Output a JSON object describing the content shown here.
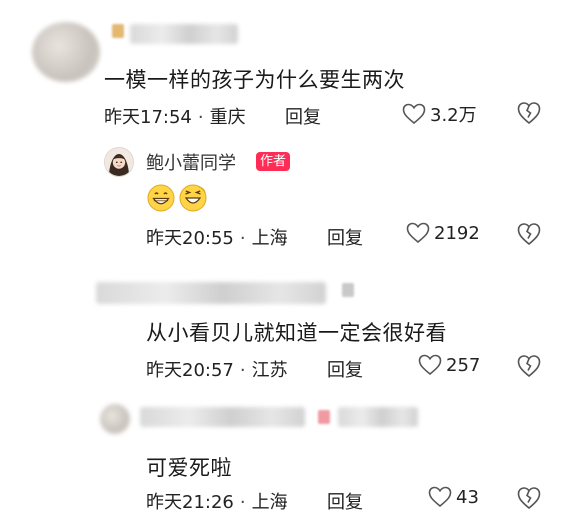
{
  "comments": [
    {
      "text": "一模一样的孩子为什么要生两次",
      "time": "昨天17:54",
      "location": "重庆",
      "reply_label": "回复",
      "likes": "3.2万"
    },
    {
      "author": "鲍小蕾同学",
      "badge": "作者",
      "emoji": [
        "grin-emoji",
        "laugh-emoji"
      ],
      "time": "昨天20:55",
      "location": "上海",
      "reply_label": "回复",
      "likes": "2192"
    },
    {
      "text": "从小看贝儿就知道一定会很好看",
      "time": "昨天20:57",
      "location": "江苏",
      "reply_label": "回复",
      "likes": "257"
    },
    {
      "text": "可爱死啦",
      "time": "昨天21:26",
      "location": "上海",
      "reply_label": "回复",
      "likes": "43"
    }
  ],
  "separator": "·",
  "colors": {
    "badge": "#ff2d55",
    "text": "#1a1a1a",
    "meta": "#222222"
  }
}
